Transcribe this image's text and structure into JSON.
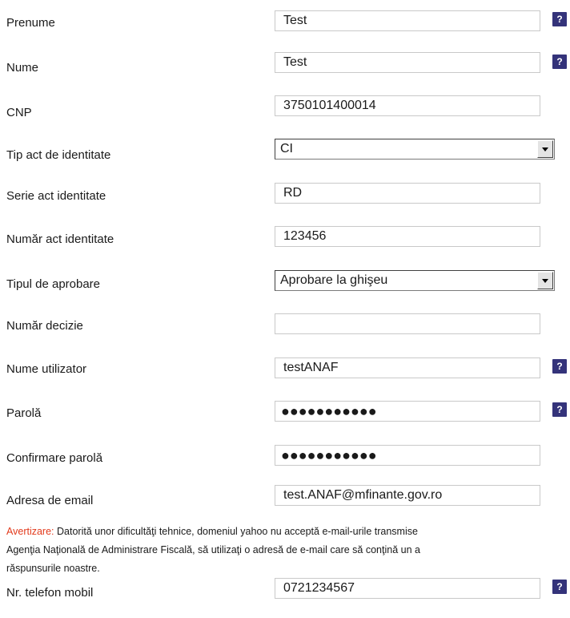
{
  "form": {
    "fields": [
      {
        "label": "Prenume",
        "value": "Test",
        "help": "?"
      },
      {
        "label": "Nume",
        "value": "Test",
        "help": "?"
      },
      {
        "label": "CNP",
        "value": "3750101400014"
      },
      {
        "label": "Tip act de identitate",
        "value": "CI"
      },
      {
        "label": "Serie act identitate",
        "value": "RD"
      },
      {
        "label": "Număr act identitate",
        "value": "123456"
      },
      {
        "label": "Tipul de aprobare",
        "value": "Aprobare la ghişeu"
      },
      {
        "label": "Număr decizie",
        "value": ""
      },
      {
        "label": "Nume utilizator",
        "value": "testANAF",
        "help": "?"
      },
      {
        "label": "Parolă",
        "value": "●●●●●●●●●●●",
        "help": "?"
      },
      {
        "label": "Confirmare parolă",
        "value": "●●●●●●●●●●●"
      },
      {
        "label": "Adresa de email",
        "value": "test.ANAF@mfinante.gov.ro"
      },
      {
        "label": "Nr. telefon mobil",
        "value": "0721234567",
        "help": "?"
      }
    ],
    "warning": {
      "label": "Avertizare:",
      "line1": "Datorită unor dificultăţi tehnice, domeniul yahoo nu acceptă e-mail-urile transmise",
      "line2": "Agenţia Naţională de Administrare Fiscală, să utilizaţi o adresă de e-mail care să conţină un a",
      "line3": "răspunsurile noastre."
    }
  }
}
